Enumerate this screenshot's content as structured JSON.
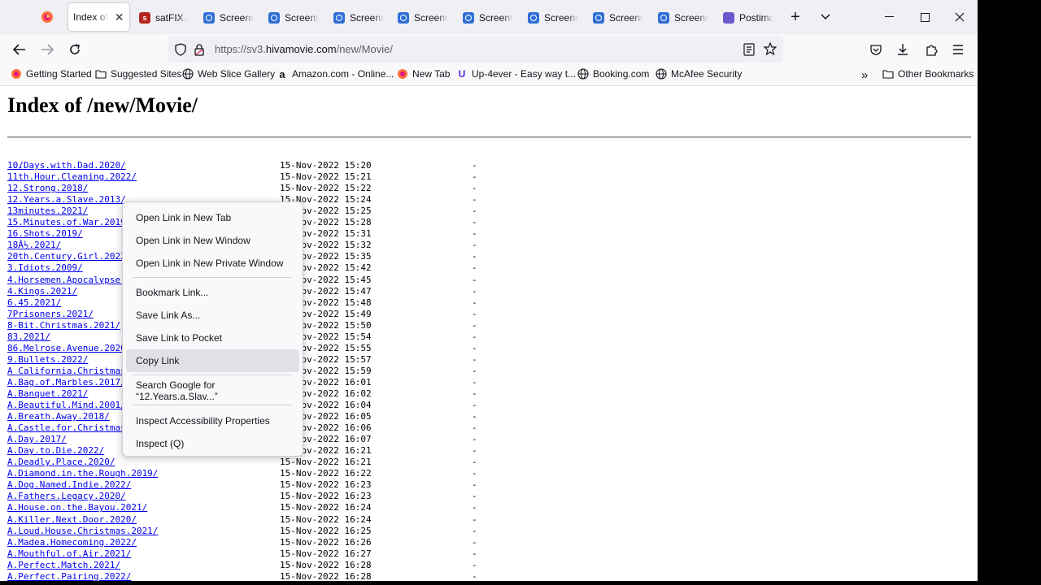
{
  "window": {
    "tabs": [
      {
        "title": "Index of",
        "icon": "folder-icon",
        "active": true
      },
      {
        "title": "satFIX.tv",
        "icon": "satfix-icon"
      },
      {
        "title": "Screens",
        "icon": "image-icon"
      },
      {
        "title": "Screens",
        "icon": "image-icon"
      },
      {
        "title": "Screens",
        "icon": "image-icon"
      },
      {
        "title": "Screens",
        "icon": "image-icon"
      },
      {
        "title": "Screens",
        "icon": "image-icon"
      },
      {
        "title": "Screens",
        "icon": "image-icon"
      },
      {
        "title": "Screens",
        "icon": "image-icon"
      },
      {
        "title": "Screens",
        "icon": "image-icon"
      },
      {
        "title": "Postima",
        "icon": "postimage-icon"
      }
    ]
  },
  "navbar": {
    "url_prefix": "https://sv3.",
    "url_host": "hivamovie.com",
    "url_path": "/new/Movie/"
  },
  "bookmarks": [
    {
      "label": "Getting Started",
      "icon": "firefox-icon"
    },
    {
      "label": "Suggested Sites",
      "icon": "folder-icon"
    },
    {
      "label": "Web Slice Gallery",
      "icon": "globe-icon"
    },
    {
      "label": "Amazon.com - Online...",
      "icon": "amazon-icon"
    },
    {
      "label": "New Tab",
      "icon": "firefox-icon"
    },
    {
      "label": "Up-4ever - Easy way t...",
      "icon": "upload-icon"
    },
    {
      "label": "Booking.com",
      "icon": "globe-icon"
    },
    {
      "label": "McAfee Security",
      "icon": "globe-icon"
    },
    {
      "label": "Other Bookmarks",
      "icon": "folder-icon"
    }
  ],
  "page": {
    "title": "Index of /new/Movie/",
    "parent_link": "../",
    "size_dash": "-",
    "rows": [
      {
        "name": "10.Days.with.Dad.2020/",
        "date": "15-Nov-2022 15:20"
      },
      {
        "name": "11th.Hour.Cleaning.2022/",
        "date": "15-Nov-2022 15:21"
      },
      {
        "name": "12.Strong.2018/",
        "date": "15-Nov-2022 15:22"
      },
      {
        "name": "12.Years.a.Slave.2013/",
        "date": "15-Nov-2022 15:24"
      },
      {
        "name": "13minutes.2021/",
        "date": "15-Nov-2022 15:25"
      },
      {
        "name": "15.Minutes.of.War.2019/",
        "date": "15-Nov-2022 15:28"
      },
      {
        "name": "16.Shots.2019/",
        "date": "15-Nov-2022 15:31"
      },
      {
        "name": "18Â½.2021/",
        "date": "15-Nov-2022 15:32"
      },
      {
        "name": "20th.Century.Girl.2022/",
        "date": "15-Nov-2022 15:35"
      },
      {
        "name": "3.Idiots.2009/",
        "date": "15-Nov-2022 15:42"
      },
      {
        "name": "4.Horsemen.Apocalypse.2022/",
        "date": "15-Nov-2022 15:45"
      },
      {
        "name": "4.Kings.2021/",
        "date": "15-Nov-2022 15:47"
      },
      {
        "name": "6.45.2021/",
        "date": "15-Nov-2022 15:48"
      },
      {
        "name": "7Prisoners.2021/",
        "date": "15-Nov-2022 15:49"
      },
      {
        "name": "8-Bit.Christmas.2021/",
        "date": "15-Nov-2022 15:50"
      },
      {
        "name": "83.2021/",
        "date": "15-Nov-2022 15:54"
      },
      {
        "name": "86.Melrose.Avenue.2020/",
        "date": "15-Nov-2022 15:55"
      },
      {
        "name": "9.Bullets.2022/",
        "date": "15-Nov-2022 15:57"
      },
      {
        "name": "A California.Christmas.2020/",
        "date": "15-Nov-2022 15:59"
      },
      {
        "name": "A.Bag.of.Marbles.2017/",
        "date": "15-Nov-2022 16:01"
      },
      {
        "name": "A.Banquet.2021/",
        "date": "15-Nov-2022 16:02"
      },
      {
        "name": "A.Beautiful.Mind.2001/",
        "date": "15-Nov-2022 16:04"
      },
      {
        "name": "A.Breath.Away.2018/",
        "date": "15-Nov-2022 16:05"
      },
      {
        "name": "A.Castle.for.Christmas.2021/",
        "date": "15-Nov-2022 16:06"
      },
      {
        "name": "A.Day.2017/",
        "date": "15-Nov-2022 16:07"
      },
      {
        "name": "A.Day.to.Die.2022/",
        "date": "15-Nov-2022 16:21"
      },
      {
        "name": "A.Deadly.Place.2020/",
        "date": "15-Nov-2022 16:21"
      },
      {
        "name": "A.Diamond.in.the.Rough.2019/",
        "date": "15-Nov-2022 16:22"
      },
      {
        "name": "A.Dog.Named.Indie.2022/",
        "date": "15-Nov-2022 16:23"
      },
      {
        "name": "A.Fathers.Legacy.2020/",
        "date": "15-Nov-2022 16:23"
      },
      {
        "name": "A.House.on.the.Bayou.2021/",
        "date": "15-Nov-2022 16:24"
      },
      {
        "name": "A.Killer.Next.Door.2020/",
        "date": "15-Nov-2022 16:24"
      },
      {
        "name": "A.Loud.House.Christmas.2021/",
        "date": "15-Nov-2022 16:25"
      },
      {
        "name": "A.Madea.Homecoming.2022/",
        "date": "15-Nov-2022 16:26"
      },
      {
        "name": "A.Mouthful.of.Air.2021/",
        "date": "15-Nov-2022 16:27"
      },
      {
        "name": "A.Perfect.Match.2021/",
        "date": "15-Nov-2022 16:28"
      },
      {
        "name": "A.Perfect.Pairing.2022/",
        "date": "15-Nov-2022 16:28"
      }
    ]
  },
  "context_menu": {
    "items": [
      "Open Link in New Tab",
      "Open Link in New Window",
      "Open Link in New Private Window",
      "Bookmark Link...",
      "Save Link As...",
      "Save Link to Pocket",
      "Copy Link",
      "Search Google for “12.Years.a.Slav...”",
      "Inspect Accessibility Properties",
      "Inspect (Q)"
    ],
    "highlighted": "Copy Link"
  },
  "colors": {
    "link": "#0000ee",
    "tabstrip_bg": "#f0f0f4",
    "toolbar_bg": "#f9f9fb"
  }
}
